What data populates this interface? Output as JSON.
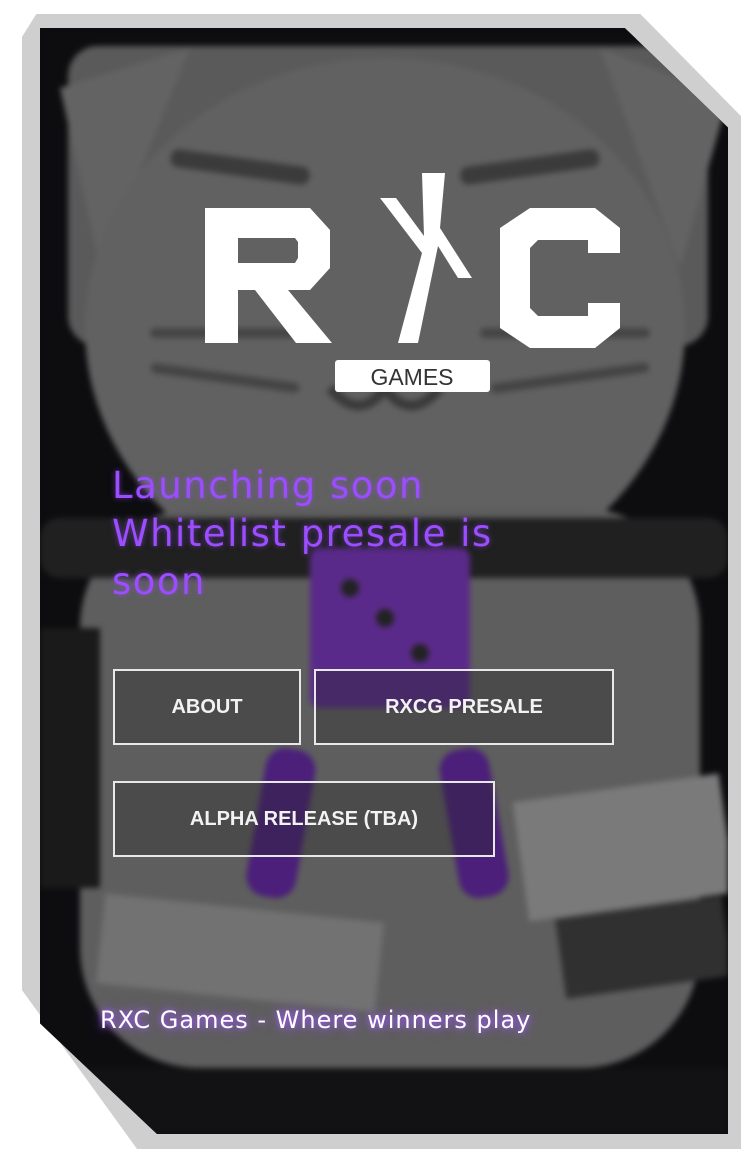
{
  "brand": {
    "logo_letters": "RXC",
    "logo_subtitle": "GAMES"
  },
  "headline": {
    "lines": [
      "Launching soon",
      "Whitelist presale is",
      "soon"
    ]
  },
  "buttons": {
    "about": "ABOUT",
    "presale": "RXCG PRESALE",
    "alpha": "ALPHA RELEASE (TBA)"
  },
  "footer": {
    "tagline": "RXC Games - Where winners play"
  },
  "colors": {
    "accent_purple": "#9b4dff",
    "panel_dark": "#0b0b0e",
    "button_border": "#e8e8e8"
  }
}
